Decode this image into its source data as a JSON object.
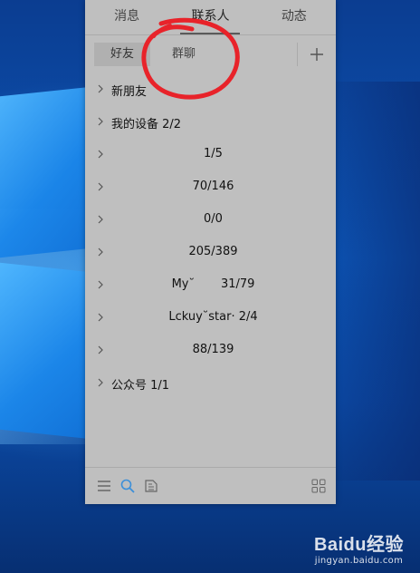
{
  "tabs": [
    {
      "label": "消息"
    },
    {
      "label": "联系人"
    },
    {
      "label": "动态"
    }
  ],
  "subtabs": {
    "friends": "好友",
    "groups": "群聊"
  },
  "list": [
    {
      "name": "新朋友",
      "count": ""
    },
    {
      "name": "我的设备",
      "count": "2/2"
    },
    {
      "name": "",
      "count": "1/5"
    },
    {
      "name": "",
      "count": "70/146"
    },
    {
      "name": "",
      "count": "0/0"
    },
    {
      "name": "",
      "count": "205/389"
    },
    {
      "name": "My˘",
      "count": "31/79"
    },
    {
      "name": "Lckuy˘star·",
      "count": "2/4"
    },
    {
      "name": "",
      "count": "88/139"
    },
    {
      "name": "公众号",
      "count": "1/1"
    }
  ],
  "watermark": {
    "brand": "Baidu经验",
    "url": "jingyan.baidu.com"
  },
  "colors": {
    "panel_bg": "#bfbfbf",
    "annotation_red": "#e8232a",
    "search_icon": "#3b8fd9"
  },
  "icons": {
    "add": "plus-icon",
    "chevron": "chevron-right-icon",
    "menu": "menu-icon",
    "search": "search-icon",
    "files": "file-icon",
    "apps": "apps-grid-icon"
  }
}
